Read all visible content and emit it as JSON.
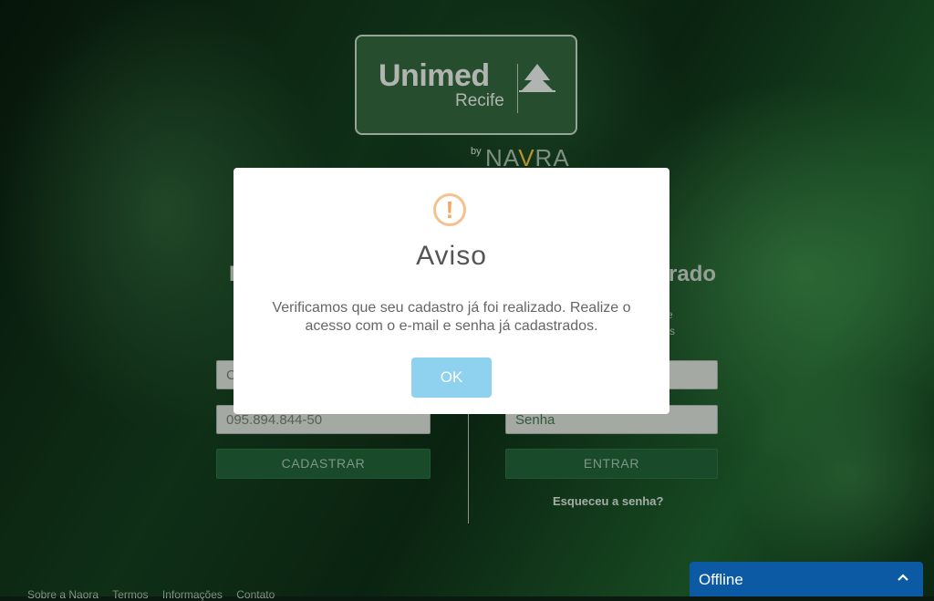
{
  "logo": {
    "word": "Unimed",
    "city": "Recife",
    "by": "by",
    "brand_prefix": "NA",
    "brand_check": "V",
    "brand_suffix": "RA"
  },
  "register": {
    "first_input_value": "C",
    "cpf_value": "095.894.844-50",
    "button": "CADASTRAR"
  },
  "login": {
    "title_partial": "rado",
    "sub_line1": "e",
    "sub_line2": "s",
    "password_placeholder": "Senha",
    "button": "ENTRAR",
    "forgot": "Esqueceu a senha?"
  },
  "left_title_partial": "I",
  "footer": {
    "links": [
      "Sobre a Naora",
      "Termos",
      "Informações",
      "Contato"
    ]
  },
  "modal": {
    "title": "Aviso",
    "message": "Verificamos que seu cadastro já foi realizado. Realize o acesso com o e-mail e senha já cadastrados.",
    "ok": "OK",
    "icon": "exclamation-circle-icon",
    "icon_glyph": "!"
  },
  "chat": {
    "label": "Offline",
    "icon": "chevron-up-icon"
  },
  "colors": {
    "modal_ok": "#8ed2ef",
    "chat_bar": "#0b5aa3",
    "warn_icon": "#f4c28f"
  }
}
